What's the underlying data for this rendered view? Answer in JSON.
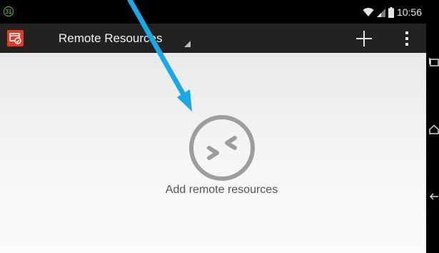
{
  "status_bar": {
    "notification_count": "31",
    "time": "10:56"
  },
  "action_bar": {
    "title": "Remote Resources"
  },
  "empty_state": {
    "message": "Add remote resources"
  },
  "icons": {
    "app": "remote-desktop-icon",
    "add": "plus-icon",
    "overflow": "overflow-menu-icon",
    "empty": "remote-connection-icon",
    "wifi": "wifi-icon",
    "signal": "cell-signal-icon",
    "battery": "battery-icon",
    "recent": "recent-apps-icon",
    "home": "home-icon",
    "back": "back-icon"
  },
  "colors": {
    "accent": "#d6402b",
    "action_bar": "#222222",
    "annotation_arrow": "#1aa9e6",
    "empty_icon": "#9a9ea1"
  }
}
